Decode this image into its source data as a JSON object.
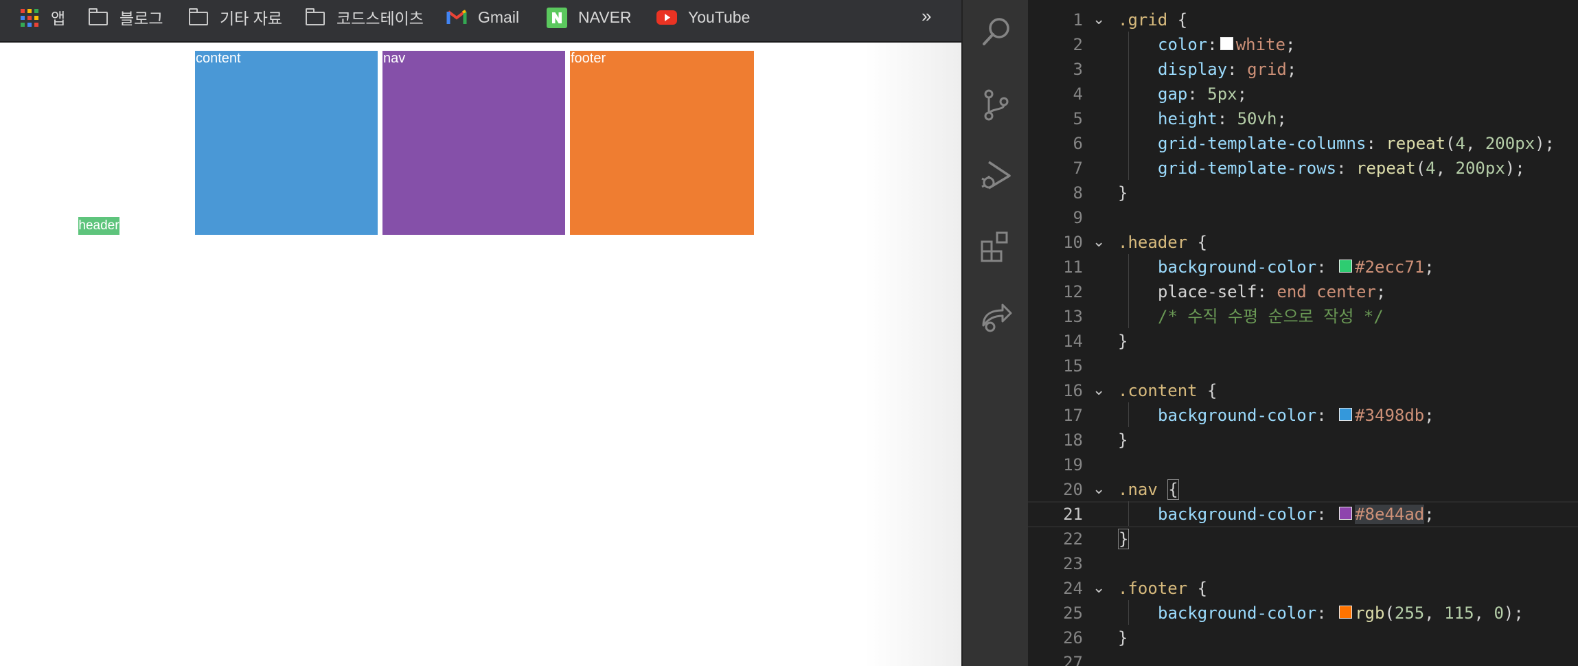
{
  "bookmarks": {
    "items": [
      {
        "label": "앱",
        "icon": "apps-grid-icon"
      },
      {
        "label": "블로그",
        "icon": "folder-icon"
      },
      {
        "label": "기타 자료",
        "icon": "folder-icon"
      },
      {
        "label": "코드스테이츠",
        "icon": "folder-icon"
      },
      {
        "label": "Gmail",
        "icon": "gmail-icon"
      },
      {
        "label": "NAVER",
        "icon": "naver-icon"
      },
      {
        "label": "YouTube",
        "icon": "youtube-icon"
      }
    ],
    "more": "»"
  },
  "grid_demo": {
    "content": {
      "label": "content",
      "color": "#4a98d6"
    },
    "nav": {
      "label": "nav",
      "color": "#8550a9"
    },
    "footer": {
      "label": "footer",
      "color": "#ef7d31"
    },
    "header": {
      "label": "header",
      "color": "#5ec47c"
    }
  },
  "editor": {
    "activity_icons": [
      "search-icon",
      "source-control-icon",
      "run-debug-icon",
      "extensions-icon",
      "live-share-icon"
    ],
    "active_line": 21,
    "lines": [
      {
        "n": "1",
        "t": ".grid {"
      },
      {
        "n": "2",
        "t": "color: white;"
      },
      {
        "n": "3",
        "t": "display: grid;"
      },
      {
        "n": "4",
        "t": "gap: 5px;"
      },
      {
        "n": "5",
        "t": "height: 50vh;"
      },
      {
        "n": "6",
        "t": "grid-template-columns: repeat(4, 200px);"
      },
      {
        "n": "7",
        "t": "grid-template-rows: repeat(4, 200px);"
      },
      {
        "n": "8",
        "t": "}"
      },
      {
        "n": "9",
        "t": ""
      },
      {
        "n": "10",
        "t": ".header {"
      },
      {
        "n": "11",
        "t": "background-color: #2ecc71;"
      },
      {
        "n": "12",
        "t": "place-self: end center;"
      },
      {
        "n": "13",
        "t": "/* 수직 수평 순으로 작성 */"
      },
      {
        "n": "14",
        "t": "}"
      },
      {
        "n": "15",
        "t": ""
      },
      {
        "n": "16",
        "t": ".content {"
      },
      {
        "n": "17",
        "t": "background-color: #3498db;"
      },
      {
        "n": "18",
        "t": "}"
      },
      {
        "n": "19",
        "t": ""
      },
      {
        "n": "20",
        "t": ".nav {"
      },
      {
        "n": "21",
        "t": "background-color: #8e44ad;"
      },
      {
        "n": "22",
        "t": "}"
      },
      {
        "n": "23",
        "t": ""
      },
      {
        "n": "24",
        "t": ".footer {"
      },
      {
        "n": "25",
        "t": "background-color: rgb(255, 115, 0);"
      },
      {
        "n": "26",
        "t": "}"
      },
      {
        "n": "27",
        "t": ""
      }
    ],
    "tokens": {
      "l1_sel": ".grid",
      "l1_b": "{",
      "l2_p": "color",
      "l2_v": "white",
      "l3_p": "display",
      "l3_v": "grid",
      "l4_p": "gap",
      "l4_v": "5px",
      "l5_p": "height",
      "l5_v": "50vh",
      "l6_p": "grid-template-columns",
      "l6_f": "repeat",
      "l6_a": "4",
      "l6_b": "200px",
      "l7_p": "grid-template-rows",
      "l7_f": "repeat",
      "l7_a": "4",
      "l7_b": "200px",
      "close": "}",
      "l10_sel": ".header",
      "bg": "background-color",
      "l11_v": "#2ecc71",
      "l12_p": "place-self",
      "l12_v": "end center",
      "l13_c": "/* 수직 수평 순으로 작성 */",
      "l16_sel": ".content",
      "l17_v": "#3498db",
      "l20_sel": ".nav",
      "l21_v": "#8e44ad",
      "l24_sel": ".footer",
      "l25_f": "rgb",
      "l25_a": "255",
      "l25_b": "115",
      "l25_c": "0"
    },
    "swatches": {
      "white": "#ffffff",
      "green": "#2ecc71",
      "blue": "#3498db",
      "purple": "#8e44ad",
      "orange": "#ff7300"
    }
  }
}
